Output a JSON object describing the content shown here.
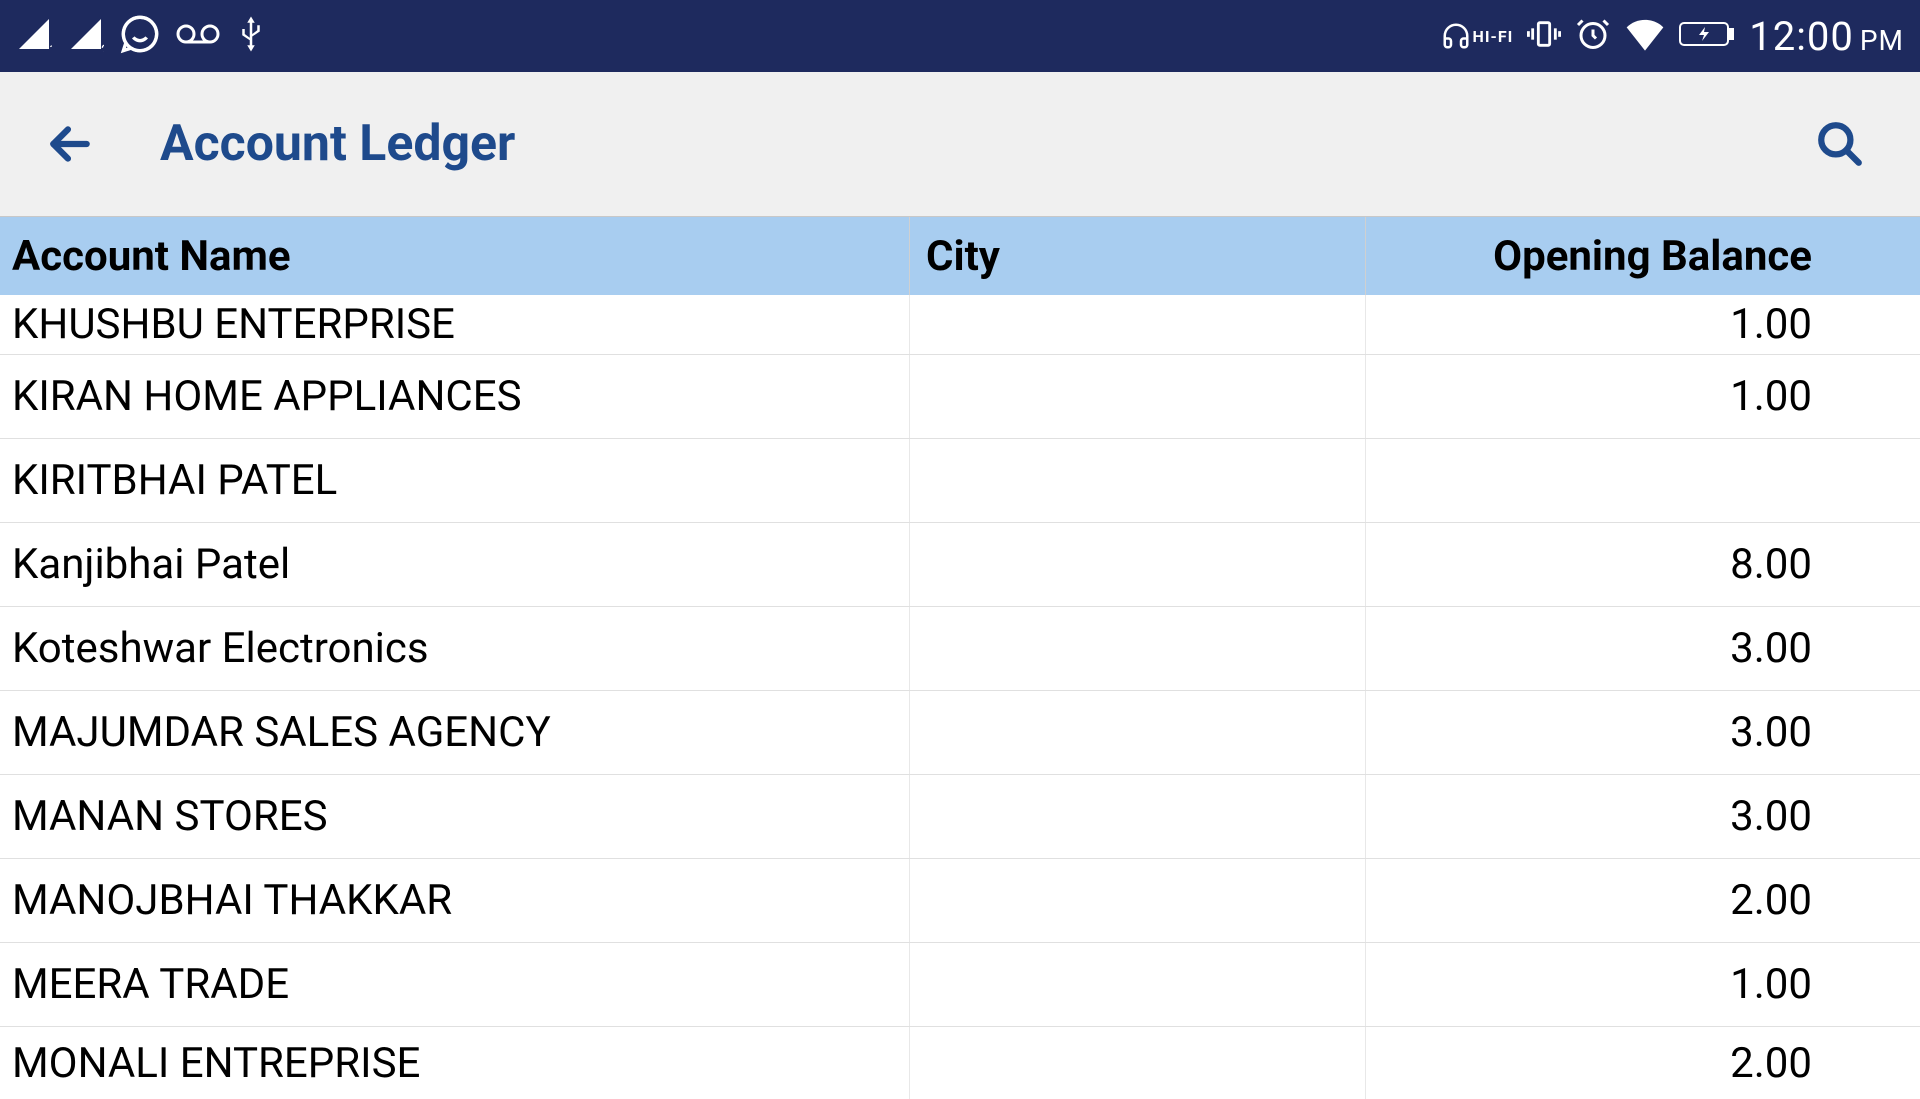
{
  "status": {
    "time": "12:00",
    "ampm": "PM",
    "hifi": "HI-FI"
  },
  "header": {
    "title": "Account Ledger"
  },
  "table": {
    "columns": {
      "name": "Account Name",
      "city": "City",
      "balance": "Opening Balance"
    },
    "rows": [
      {
        "name": "KHUSHBU ENTERPRISE",
        "city": "",
        "balance": "1.00"
      },
      {
        "name": "KIRAN HOME APPLIANCES",
        "city": "",
        "balance": "1.00"
      },
      {
        "name": "KIRITBHAI PATEL",
        "city": "",
        "balance": ""
      },
      {
        "name": "Kanjibhai Patel",
        "city": "",
        "balance": "8.00"
      },
      {
        "name": "Koteshwar Electronics",
        "city": "",
        "balance": "3.00"
      },
      {
        "name": "MAJUMDAR SALES AGENCY",
        "city": "",
        "balance": "3.00"
      },
      {
        "name": "MANAN STORES",
        "city": "",
        "balance": "3.00"
      },
      {
        "name": "MANOJBHAI THAKKAR",
        "city": "",
        "balance": "2.00"
      },
      {
        "name": "MEERA TRADE",
        "city": "",
        "balance": "1.00"
      },
      {
        "name": "MONALI ENTREPRISE",
        "city": "",
        "balance": "2.00"
      }
    ]
  }
}
